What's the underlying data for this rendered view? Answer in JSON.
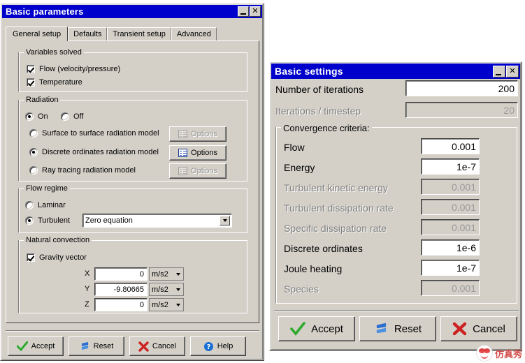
{
  "basic_parameters": {
    "title": "Basic parameters",
    "window_buttons": {
      "minimize": "_",
      "close": "✕"
    },
    "tabs": [
      {
        "label": "General setup",
        "active": true
      },
      {
        "label": "Defaults",
        "active": false
      },
      {
        "label": "Transient setup",
        "active": false
      },
      {
        "label": "Advanced",
        "active": false
      }
    ],
    "variables_solved": {
      "title": "Variables solved",
      "items": [
        {
          "label": "Flow (velocity/pressure)",
          "checked": true
        },
        {
          "label": "Temperature",
          "checked": true
        }
      ]
    },
    "radiation": {
      "title": "Radiation",
      "on_label": "On",
      "on_selected": true,
      "off_label": "Off",
      "off_selected": false,
      "models": [
        {
          "label": "Surface to surface radiation model",
          "selected": false,
          "options_label": "Options",
          "options_enabled": false
        },
        {
          "label": "Discrete ordinates radiation model",
          "selected": true,
          "options_label": "Options",
          "options_enabled": true
        },
        {
          "label": "Ray tracing radiation model",
          "selected": false,
          "options_label": "Options",
          "options_enabled": false
        }
      ]
    },
    "flow_regime": {
      "title": "Flow regime",
      "laminar_label": "Laminar",
      "laminar_selected": false,
      "turbulent_label": "Turbulent",
      "turbulent_selected": true,
      "turbulence_model": "Zero equation"
    },
    "natural_convection": {
      "title": "Natural convection",
      "gravity_vector_label": "Gravity vector",
      "gravity_vector_checked": true,
      "components": [
        {
          "axis": "X",
          "value": "0",
          "unit": "m/s2"
        },
        {
          "axis": "Y",
          "value": "-9.80665",
          "unit": "m/s2"
        },
        {
          "axis": "Z",
          "value": "0",
          "unit": "m/s2"
        }
      ]
    },
    "buttons": [
      {
        "label": "Accept",
        "icon": "green-check-icon"
      },
      {
        "label": "Reset",
        "icon": "blue-refresh-icon"
      },
      {
        "label": "Cancel",
        "icon": "red-x-icon"
      },
      {
        "label": "Help",
        "icon": "blue-question-icon"
      }
    ]
  },
  "basic_settings": {
    "title": "Basic settings",
    "window_buttons": {
      "minimize": "_",
      "close": "✕"
    },
    "number_of_iterations": {
      "label": "Number of iterations",
      "value": "200",
      "enabled": true
    },
    "iterations_per_timestep": {
      "label": "Iterations / timestep",
      "value": "20",
      "enabled": false
    },
    "convergence": {
      "title": "Convergence criteria:",
      "rows": [
        {
          "label": "Flow",
          "value": "0.001",
          "enabled": true
        },
        {
          "label": "Energy",
          "value": "1e-7",
          "enabled": true
        },
        {
          "label": "Turbulent kinetic energy",
          "value": "0.001",
          "enabled": false
        },
        {
          "label": "Turbulent dissipation rate",
          "value": "0.001",
          "enabled": false
        },
        {
          "label": "Specific dissipation rate",
          "value": "0.001",
          "enabled": false
        },
        {
          "label": "Discrete ordinates",
          "value": "1e-6",
          "enabled": true
        },
        {
          "label": "Joule heating",
          "value": "1e-7",
          "enabled": true
        },
        {
          "label": "Species",
          "value": "0.001",
          "enabled": false
        }
      ]
    },
    "buttons": [
      {
        "label": "Accept",
        "icon": "green-check-icon"
      },
      {
        "label": "Reset",
        "icon": "blue-refresh-icon"
      },
      {
        "label": "Cancel",
        "icon": "red-x-icon"
      }
    ]
  },
  "watermark": {
    "text": "仿真秀",
    "icon": "wechat-official-account-icon"
  },
  "theme": {
    "titlebar_blue": "#0000cc",
    "dialog_face": "#d4d0c8",
    "field_white": "#ffffff",
    "disabled_text": "#9a9a9a",
    "accent_green": "#2eaa2e",
    "accent_red": "#cc2222",
    "accent_blue": "#1a6fd4"
  }
}
